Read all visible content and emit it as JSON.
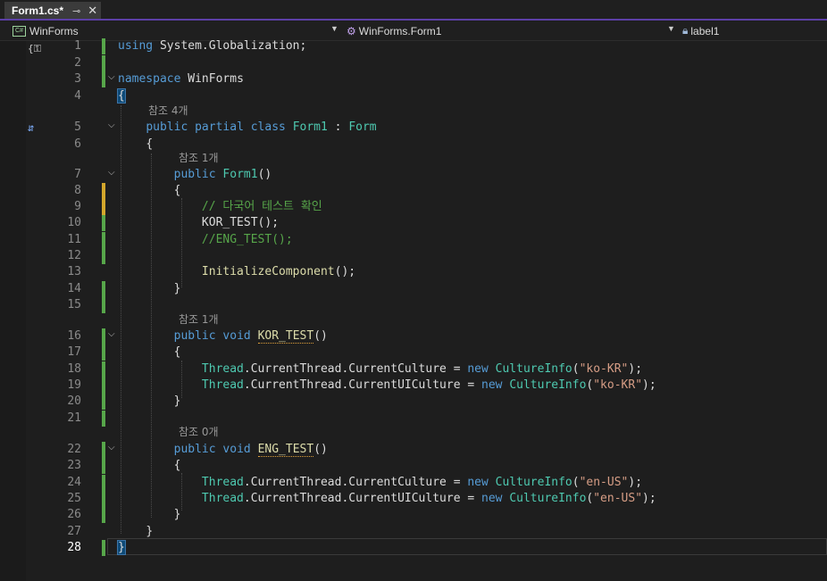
{
  "tab": {
    "title": "Form1.cs*",
    "pin_glyph": "⊸",
    "close_glyph": "✕"
  },
  "navbar": {
    "project_icon": "C#",
    "project": "WinForms",
    "class_icon": "class-icon",
    "class": "WinForms.Form1",
    "member_icon": "field-icon",
    "member": "label1"
  },
  "gutter_glyphs": {
    "top": "{⚿",
    "bookmark": "⇵"
  },
  "code_lens": [
    "참조 4개",
    "참조 1개",
    "참조 1개",
    "참조 0개"
  ],
  "lines": [
    {
      "n": "1"
    },
    {
      "n": "2"
    },
    {
      "n": "3"
    },
    {
      "n": "4"
    },
    {
      "n": "5"
    },
    {
      "n": "6"
    },
    {
      "n": "7"
    },
    {
      "n": "8"
    },
    {
      "n": "9"
    },
    {
      "n": "10"
    },
    {
      "n": "11"
    },
    {
      "n": "12"
    },
    {
      "n": "13"
    },
    {
      "n": "14"
    },
    {
      "n": "15"
    },
    {
      "n": "16"
    },
    {
      "n": "17"
    },
    {
      "n": "18"
    },
    {
      "n": "19"
    },
    {
      "n": "20"
    },
    {
      "n": "21"
    },
    {
      "n": "22"
    },
    {
      "n": "23"
    },
    {
      "n": "24"
    },
    {
      "n": "25"
    },
    {
      "n": "26"
    },
    {
      "n": "27"
    },
    {
      "n": "28"
    }
  ],
  "tokens": {
    "using": "using",
    "system_glob": " System.Globalization;",
    "namespace": "namespace",
    "winforms": " WinForms",
    "open": "{",
    "close": "}",
    "public": "public",
    "partial": "partial",
    "class": "class",
    "form1": "Form1",
    "colon": " : ",
    "form": "Form",
    "form1_ctor": "Form1",
    "parens": "()",
    "comment_kr": "// 다국어 테스트 확인",
    "kor_call": "KOR_TEST",
    "call_end": "();",
    "eng_comment": "//ENG_TEST();",
    "init": "InitializeComponent",
    "void": "void",
    "kor_test": "KOR_TEST",
    "eng_test": "ENG_TEST",
    "thread": "Thread",
    "cur_culture": ".CurrentThread.CurrentCulture = ",
    "cur_ui_culture": ".CurrentThread.CurrentUICulture = ",
    "new": "new",
    "culture_info": "CultureInfo",
    "ko": "\"ko-KR\"",
    "en": "\"en-US\"",
    "lp": "(",
    "rp_semi": ");"
  }
}
